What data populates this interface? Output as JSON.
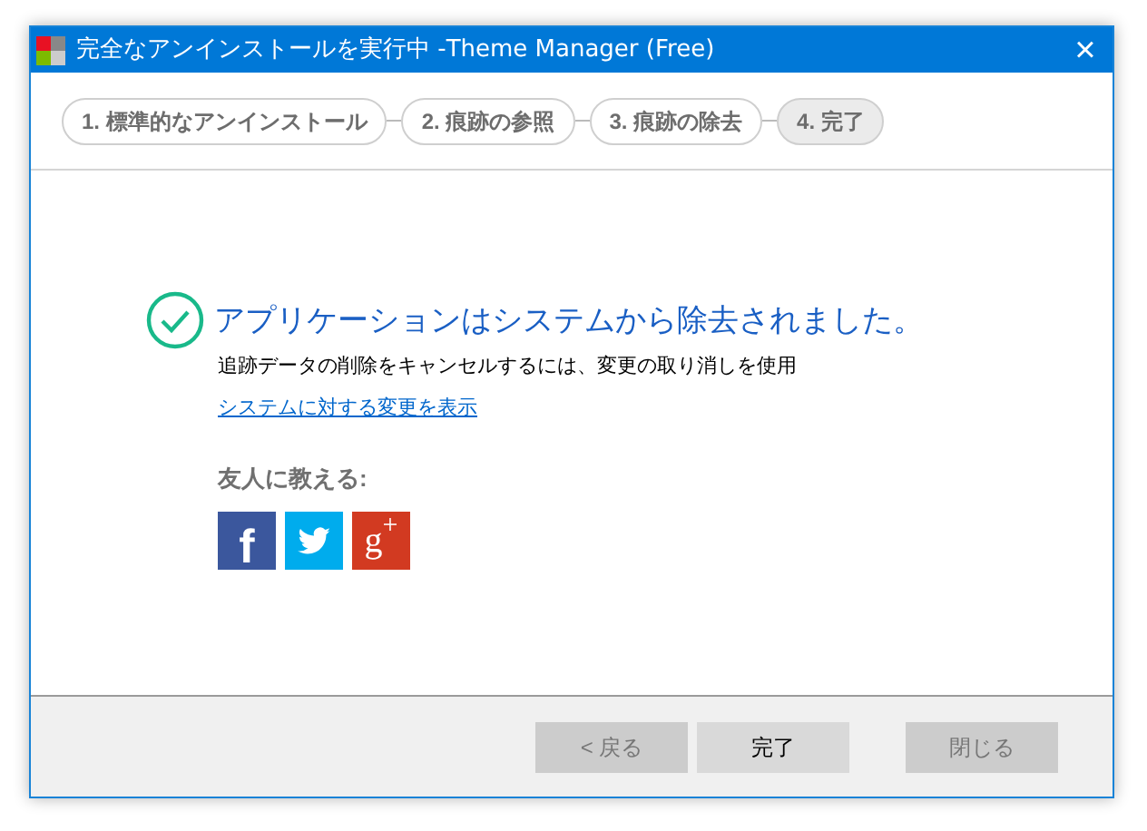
{
  "window": {
    "title": "完全なアンインストールを実行中 -Theme Manager (Free)",
    "close": "×"
  },
  "steps": [
    {
      "label": "1. 標準的なアンインストール",
      "selected": false
    },
    {
      "label": "2. 痕跡の参照",
      "selected": false
    },
    {
      "label": "3. 痕跡の除去",
      "selected": false
    },
    {
      "label": "4. 完了",
      "selected": true
    }
  ],
  "result": {
    "heading": "アプリケーションはシステムから除去されました。",
    "note": "追跡データの削除をキャンセルするには、変更の取り消しを使用",
    "link": "システムに対する変更を表示"
  },
  "share": {
    "label": "友人に教える:",
    "buttons": [
      {
        "kind": "facebook",
        "label": "f"
      },
      {
        "kind": "twitter"
      },
      {
        "kind": "googleplus",
        "label": "g$^{+}$"
      }
    ]
  },
  "buttons": [
    {
      "label": "< 戻る",
      "disabled": true
    },
    {
      "label": "完了",
      "disabled": false
    },
    {
      "label": "閉じる",
      "disabled": true
    }
  ]
}
